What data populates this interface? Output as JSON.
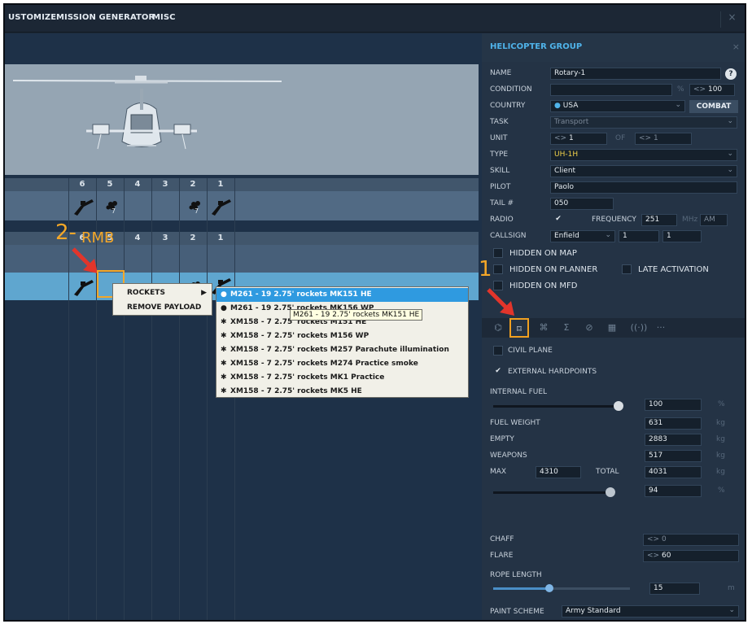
{
  "menu": {
    "items": [
      "USTOMIZE",
      "MISSION GENERATOR",
      "MISC"
    ],
    "close_glyph": "×"
  },
  "loadout": {
    "pylon_numbers": [
      "6",
      "5",
      "4",
      "3",
      "2",
      "1"
    ],
    "top_row_counts": [
      "7",
      "7"
    ],
    "annotation_step2": "2-",
    "annotation_rmb": "RMB",
    "annotation_step1": "1",
    "icons": [
      "rocket-pod-icon",
      "rocket-cluster-icon",
      "helicopter-preview"
    ]
  },
  "context_menu": {
    "items": [
      "ROCKETS",
      "REMOVE PAYLOAD"
    ],
    "submenu_arrow": "▶"
  },
  "submenu": {
    "items": [
      "M261 - 19 2.75' rockets MK151 HE",
      "M261 - 19 2.75' rockets MK156 WP",
      "XM158 - 7 2.75' rockets M151 HE",
      "XM158 - 7 2.75' rockets M156 WP",
      "XM158 - 7 2.75' rockets M257 Parachute illumination",
      "XM158 - 7 2.75' rockets M274 Practice smoke",
      "XM158 - 7 2.75' rockets MK1 Practice",
      "XM158 - 7 2.75' rockets MK5 HE"
    ],
    "selected_index": 0
  },
  "tooltip": "M261 - 19 2.75' rockets MK151 HE",
  "panel": {
    "title": "HELICOPTER GROUP",
    "close_glyph": "×",
    "name_label": "NAME",
    "name_value": "Rotary-1",
    "help_glyph": "?",
    "condition_label": "CONDITION",
    "condition_unit": "%",
    "condition_value": "100",
    "stepper_glyph": "<>",
    "country_label": "COUNTRY",
    "country_value": "USA",
    "combat_label": "COMBAT",
    "task_label": "TASK",
    "task_value": "Transport",
    "unit_label": "UNIT",
    "unit_value": "1",
    "of_label": "OF",
    "of_value": "1",
    "type_label": "TYPE",
    "type_value": "UH-1H",
    "skill_label": "SKILL",
    "skill_value": "Client",
    "pilot_label": "PILOT",
    "pilot_value": "Paolo",
    "tail_label": "TAIL #",
    "tail_value": "050",
    "radio_label": "RADIO",
    "frequency_label": "FREQUENCY",
    "frequency_value": "251",
    "mhz_label": "MHz",
    "am_value": "AM",
    "callsign_label": "CALLSIGN",
    "callsign_value": "Enfield",
    "callsign_num1": "1",
    "callsign_num2": "1",
    "hidden_on_map": "HIDDEN ON MAP",
    "hidden_on_planner": "HIDDEN ON PLANNER",
    "late_activation": "LATE ACTIVATION",
    "hidden_on_mfd": "HIDDEN ON MFD",
    "check_glyph": "✔",
    "dropdown_glyph": "⌄",
    "tabs": [
      "route-icon",
      "loadout-icon",
      "actions-icon",
      "summary-icon",
      "failures-icon",
      "payload-icon",
      "radio-icon",
      "more-icon"
    ],
    "tab_glyphs": [
      "⌬",
      "⌑",
      "⌘",
      "Σ",
      "⊘",
      "▦",
      "((·))",
      "···"
    ],
    "civil_plane": "CIVIL PLANE",
    "external_hardpoints": "EXTERNAL HARDPOINTS",
    "internal_fuel_label": "INTERNAL FUEL",
    "internal_fuel_value": "100",
    "internal_fuel_unit": "%",
    "fuel_weight_label": "FUEL WEIGHT",
    "fuel_weight_value": "631",
    "empty_label": "EMPTY",
    "empty_value": "2883",
    "weapons_label": "WEAPONS",
    "weapons_value": "517",
    "max_label": "MAX",
    "max_value": "4310",
    "total_label": "TOTAL",
    "total_value": "4031",
    "weight_unit": "kg",
    "total_pct_value": "94",
    "total_pct_unit": "%",
    "chaff_label": "CHAFF",
    "chaff_value": "0",
    "flare_label": "FLARE",
    "flare_value": "60",
    "rope_length_label": "ROPE LENGTH",
    "rope_length_value": "15",
    "rope_unit": "m",
    "paint_scheme_label": "PAINT SCHEME",
    "paint_scheme_value": "Army Standard"
  },
  "colors": {
    "accent": "#f4a728",
    "title_blue": "#4fb3ea",
    "type_yellow": "#f3d34a",
    "selection": "#2f9ae0"
  }
}
